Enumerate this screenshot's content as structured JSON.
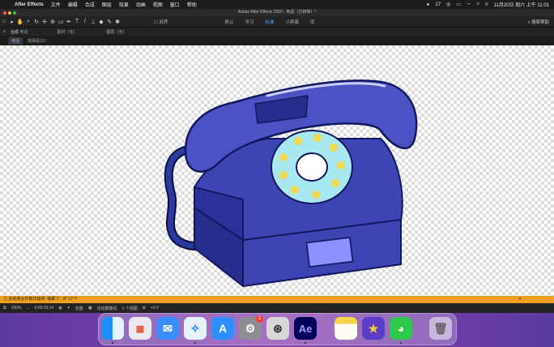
{
  "menubar": {
    "app_name": "After Effects",
    "items": [
      "文件",
      "编辑",
      "合成",
      "图层",
      "效果",
      "动画",
      "视图",
      "窗口",
      "帮助"
    ],
    "notif_count": "17",
    "datetime": "11月20日 周六 上午 11:01"
  },
  "window": {
    "title": "Adobe After Effects 2020 - 电话（已转换）*"
  },
  "toolbar": {
    "snap_label": "对齐",
    "workspaces": [
      "默认",
      "学习",
      "标准",
      "小屏幕",
      "库"
    ],
    "active_workspace": "标准",
    "search_placeholder": "搜索帮助"
  },
  "panels": {
    "comp_label": "合成",
    "comp_name": "电话",
    "material_label": "素材（无）",
    "layer_label": "图层（无）"
  },
  "tabs": {
    "active": "电话",
    "second": "描摹图167"
  },
  "warning": {
    "text": "此组成合并模式错误: 描摹\"1\", 共\"12\"个"
  },
  "viewbar": {
    "zoom": "100%",
    "timecode": "0;00;03;14",
    "quality": "完整",
    "camera": "活动摄像机",
    "views": "1 个视图",
    "exposure": "+0.0"
  },
  "dock": {
    "apps": [
      "finder-icon",
      "launchpad-icon",
      "mail-icon",
      "safari-icon",
      "app-store-icon",
      "system-preferences-icon",
      "utility-icon",
      "after-effects-icon",
      "notes-icon",
      "imovie-icon",
      "wechat-icon",
      "trash-icon"
    ],
    "ae_label": "Ae",
    "sysprefs_badge": "1"
  },
  "colors": {
    "phone_body": "#3d45b5",
    "phone_dark": "#272d8c",
    "dial": "#a8e8f0",
    "dial_holes": "#f5d94c",
    "cord": "#1a2a7a",
    "warning_bar": "#f0a020",
    "active_ws": "#4fa3ff"
  }
}
